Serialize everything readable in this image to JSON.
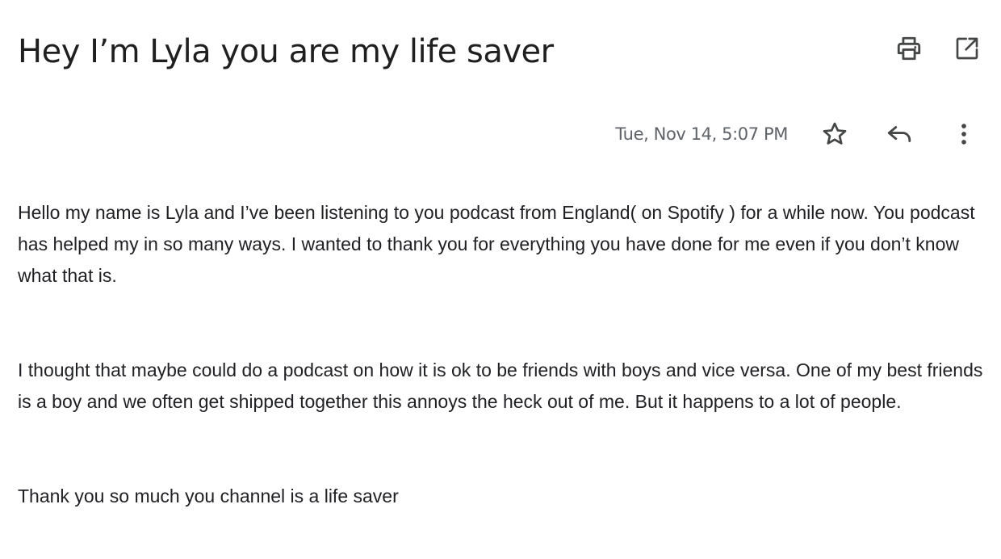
{
  "email": {
    "subject": "Hey I’m Lyla you are my life saver",
    "date": "Tue, Nov 14, 5:07 PM",
    "paragraphs": [
      "Hello my name is Lyla and I’ve been listening to you podcast from England( on Spotify ) for a while now.  You podcast has helped my in so many ways. I wanted to thank you for everything you have done for me even if you don’t know what that is.",
      "I thought that maybe could do a podcast on how it is ok to be friends with boys and vice versa. One of my best friends is a boy and we often get shipped together this annoys the heck out of me. But it happens to a lot of people.",
      "Thank you so much you channel is a life saver"
    ]
  },
  "icons": {
    "print": "printer-icon",
    "open_new_window": "open-in-new-icon",
    "star": "star-icon",
    "reply": "reply-icon",
    "more": "more-vertical-icon"
  },
  "colors": {
    "text": "#202124",
    "muted": "#5f6368",
    "icon": "#444746"
  }
}
